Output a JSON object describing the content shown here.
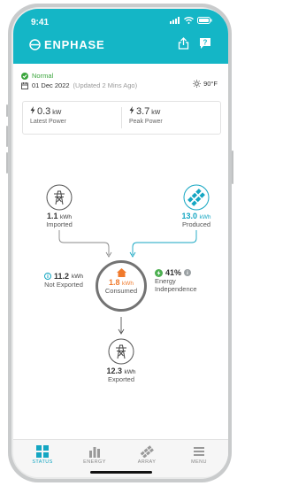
{
  "status_bar": {
    "time": "9:41"
  },
  "header": {
    "brand": "ENPHASE",
    "share_icon": "share-icon",
    "help_label": "?"
  },
  "status": {
    "state": "Normal",
    "date": "01 Dec 2022",
    "updated": "(Updated 2 Mins Ago)",
    "temperature": "90°F"
  },
  "power": {
    "latest": {
      "value": "0.3",
      "unit": "kW",
      "label": "Latest Power"
    },
    "peak": {
      "value": "3.7",
      "unit": "kW",
      "label": "Peak Power"
    }
  },
  "flow": {
    "imported": {
      "value": "1.1",
      "unit": "kWh",
      "label": "Imported"
    },
    "produced": {
      "value": "13.0",
      "unit": "kWh",
      "label": "Produced"
    },
    "consumed": {
      "value": "1.8",
      "unit": "kWh",
      "label": "Consumed"
    },
    "not_exported": {
      "value": "11.2",
      "unit": "kWh",
      "label": "Not Exported"
    },
    "independence": {
      "value": "41%",
      "label_line1": "Energy",
      "label_line2": "Independence"
    },
    "exported": {
      "value": "12.3",
      "unit": "kWh",
      "label": "Exported"
    }
  },
  "nav": [
    {
      "label": "STATUS",
      "icon": "status-grid-icon",
      "active": true
    },
    {
      "label": "ENERGY",
      "icon": "energy-bars-icon",
      "active": false
    },
    {
      "label": "ARRAY",
      "icon": "array-panels-icon",
      "active": false
    },
    {
      "label": "MENU",
      "icon": "menu-icon",
      "active": false
    }
  ],
  "colors": {
    "accent": "#14b6c6",
    "normal": "#3aa53c",
    "consumed": "#f07a2c",
    "bolt_green": "#4caf50"
  }
}
